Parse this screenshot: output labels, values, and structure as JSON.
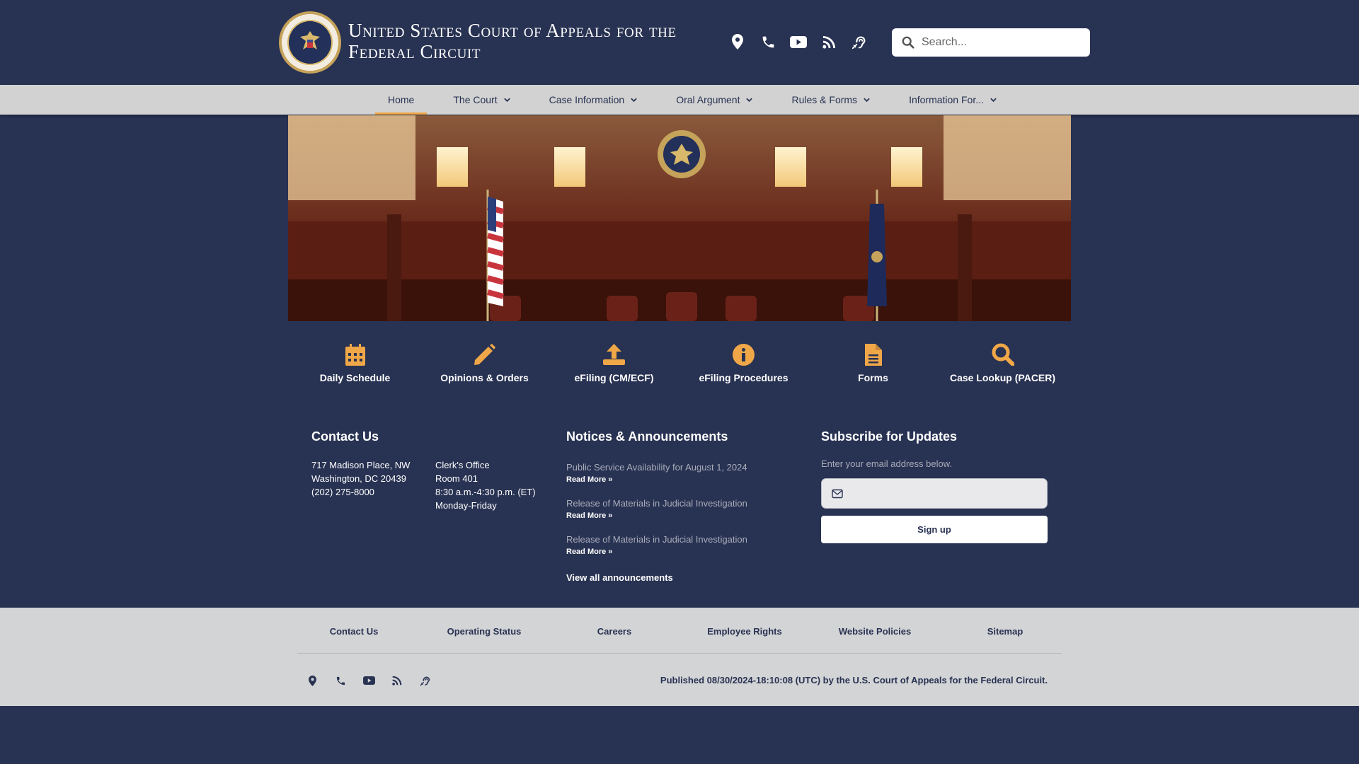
{
  "colors": {
    "navy": "#283252",
    "gold": "#f0a748",
    "nav_bg": "#d2d2d2",
    "footer_bg": "#d3d4d6",
    "muted": "#a9adbb"
  },
  "header": {
    "title": "United States Court of Appeals for the Federal Circuit",
    "seal_icon": "court-seal-icon",
    "icons": [
      "map-pin-icon",
      "phone-icon",
      "youtube-icon",
      "rss-icon",
      "hearing-assist-icon"
    ],
    "search": {
      "placeholder": "Search..."
    }
  },
  "nav": {
    "items": [
      {
        "label": "Home"
      },
      {
        "label": "The Court"
      },
      {
        "label": "Case Information"
      },
      {
        "label": "Oral Argument"
      },
      {
        "label": "Rules & Forms"
      },
      {
        "label": "Information For..."
      }
    ]
  },
  "quick_links": [
    {
      "label": "Daily Schedule",
      "icon": "calendar-icon"
    },
    {
      "label": "Opinions & Orders",
      "icon": "pencil-icon"
    },
    {
      "label": "eFiling (CM/ECF)",
      "icon": "upload-icon"
    },
    {
      "label": "eFiling Procedures",
      "icon": "info-icon"
    },
    {
      "label": "Forms",
      "icon": "document-icon"
    },
    {
      "label": "Case Lookup (PACER)",
      "icon": "search-icon"
    }
  ],
  "contact": {
    "title": "Contact Us",
    "address_1": "717 Madison Place, NW",
    "address_2": "Washington, DC 20439",
    "phone": "(202) 275-8000",
    "office": "Clerk's Office",
    "room": "Room 401",
    "hours": "8:30 a.m.-4:30 p.m. (ET)",
    "days": "Monday-Friday"
  },
  "notices": {
    "title": "Notices & Announcements",
    "items": [
      {
        "title": "Public Service Availability for August 1, 2024",
        "read_more": "Read More »"
      },
      {
        "title": "Release of Materials in Judicial Investigation",
        "read_more": "Read More »"
      },
      {
        "title": "Release of Materials in Judicial Investigation",
        "read_more": "Read More »"
      }
    ],
    "view_all": "View all announcements"
  },
  "subscribe": {
    "title": "Subscribe for Updates",
    "note": "Enter your email address below.",
    "email_value": "",
    "button": "Sign up"
  },
  "footer": {
    "links": [
      "Contact Us",
      "Operating Status",
      "Careers",
      "Employee Rights",
      "Website Policies",
      "Sitemap"
    ],
    "published": "Published 08/30/2024-18:10:08 (UTC) by the U.S. Court of Appeals for the Federal Circuit."
  }
}
